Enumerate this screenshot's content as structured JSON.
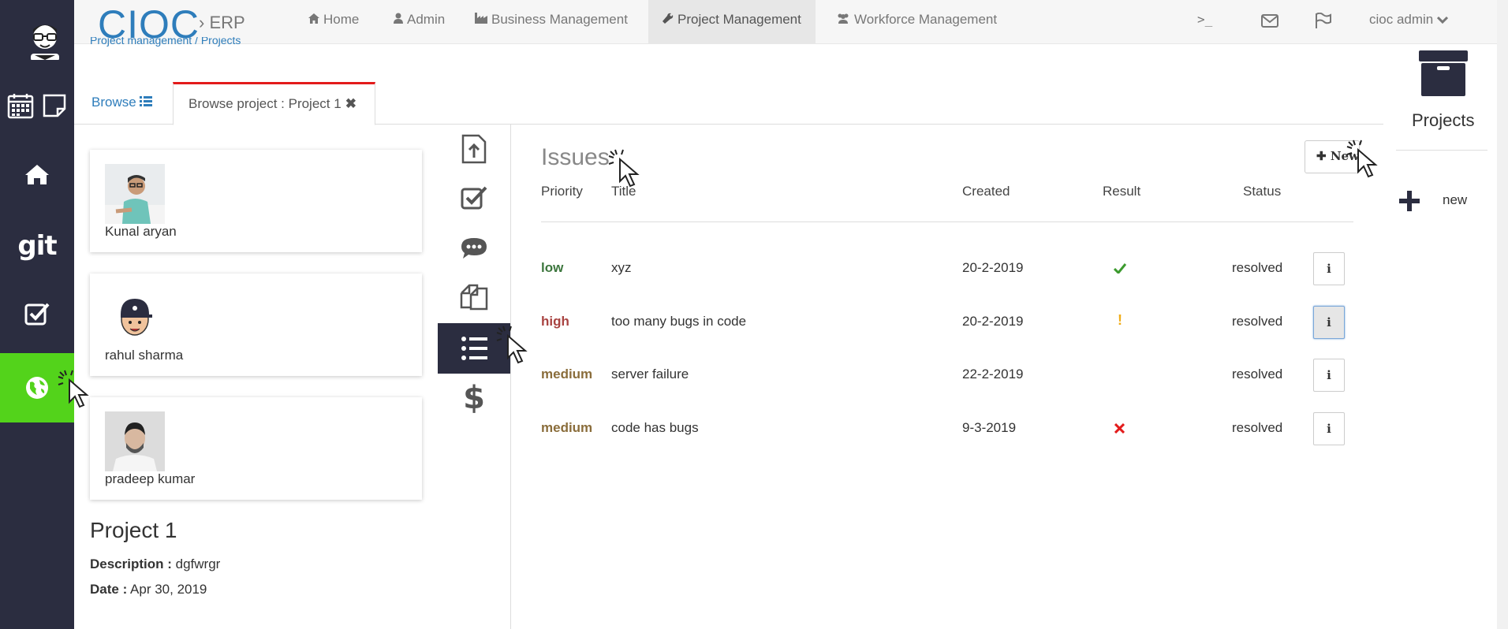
{
  "brand": {
    "name": "CIOC",
    "sub": "ERP"
  },
  "nav": [
    {
      "label": "Home",
      "icon": "home-icon"
    },
    {
      "label": "Admin",
      "icon": "user-icon"
    },
    {
      "label": "Business Management",
      "icon": "industry-icon"
    },
    {
      "label": "Project Management",
      "icon": "wrench-icon",
      "active": true
    },
    {
      "label": "Workforce Management",
      "icon": "users-icon"
    }
  ],
  "user": {
    "name": "cioc admin"
  },
  "breadcrumb": "Project management / Projects",
  "tabs": {
    "browse": "Browse",
    "browse_project": "Browse project : Project 1"
  },
  "members": [
    {
      "name": "Kunal aryan"
    },
    {
      "name": "rahul sharma"
    },
    {
      "name": "pradeep kumar"
    }
  ],
  "project": {
    "title": "Project 1",
    "description_label": "Description :",
    "description": "dgfwrgr",
    "date_label": "Date :",
    "date": "Apr 30, 2019"
  },
  "issues": {
    "heading": "Issues",
    "new_label": "New",
    "columns": {
      "priority": "Priority",
      "title": "Title",
      "created": "Created",
      "result": "Result",
      "status": "Status"
    },
    "rows": [
      {
        "priority": "low",
        "priority_color": "#3c763d",
        "title": "xyz",
        "created": "20-2-2019",
        "result": "check",
        "status": "resolved"
      },
      {
        "priority": "high",
        "priority_color": "#a94442",
        "title": "too many bugs in code",
        "created": "20-2-2019",
        "result": "exclamation",
        "status": "resolved"
      },
      {
        "priority": "medium",
        "priority_color": "#8a6d3b",
        "title": "server failure",
        "created": "22-2-2019",
        "result": "",
        "status": "resolved"
      },
      {
        "priority": "medium",
        "priority_color": "#8a6d3b",
        "title": "code has bugs",
        "created": "9-3-2019",
        "result": "cross",
        "status": "resolved"
      }
    ]
  },
  "right_panel": {
    "title": "Projects",
    "new_label": "new"
  },
  "colors": {
    "accent": "#2e7dbb",
    "rail": "#2b2d40",
    "active_green": "#53d31b",
    "tab_red": "#e31b1b"
  }
}
